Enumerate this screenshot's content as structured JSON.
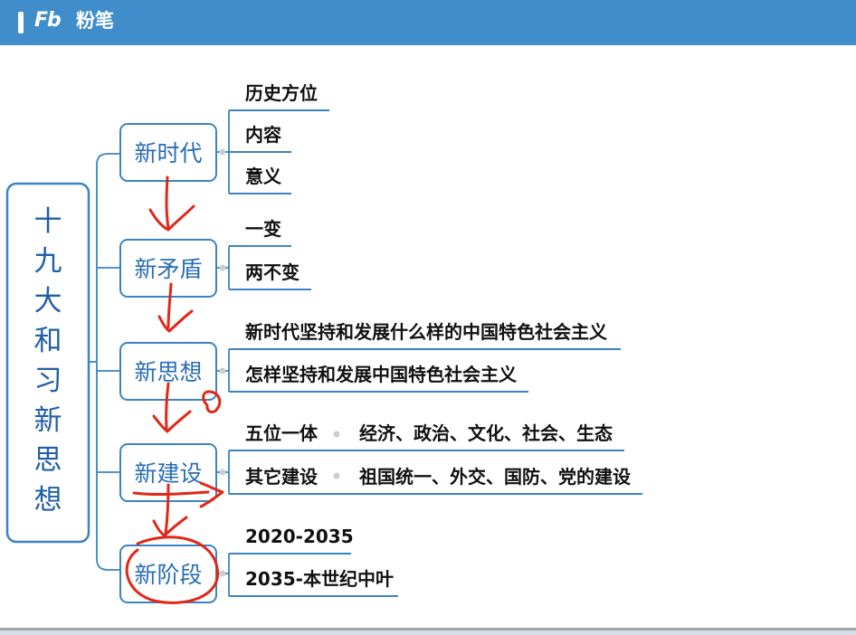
{
  "header": {
    "brand_mark": "Fb",
    "brand_name": "粉笔"
  },
  "mindmap": {
    "root": "十九大和习新思想",
    "branches": [
      {
        "label": "新时代",
        "children": [
          {
            "text": "历史方位"
          },
          {
            "text": "内容"
          },
          {
            "text": "意义"
          }
        ]
      },
      {
        "label": "新矛盾",
        "children": [
          {
            "text": "一变"
          },
          {
            "text": "两不变"
          }
        ]
      },
      {
        "label": "新思想",
        "children": [
          {
            "text": "新时代坚持和发展什么样的中国特色社会主义"
          },
          {
            "text": "怎样坚持和发展中国特色社会主义"
          }
        ]
      },
      {
        "label": "新建设",
        "children": [
          {
            "text": "五位一体",
            "detail": "经济、政治、文化、社会、生态"
          },
          {
            "text": "其它建设",
            "detail": "祖国统一、外交、国防、党的建设"
          }
        ]
      },
      {
        "label": "新阶段",
        "children": [
          {
            "text": "2020-2035"
          },
          {
            "text": "2035-本世纪中叶"
          }
        ]
      }
    ]
  },
  "colors": {
    "topbar": "#3f8ecb",
    "node_border": "#3b83c4",
    "node_text": "#2a6db5",
    "annotation": "#e02818"
  }
}
